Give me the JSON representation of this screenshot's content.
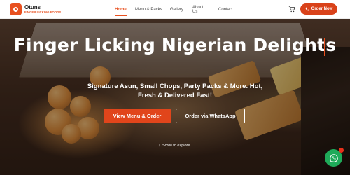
{
  "brand": {
    "name": "Otuns",
    "tagline": "FINGER LICKING FOODS",
    "accent": "#e8501f"
  },
  "nav": {
    "items": [
      {
        "label": "Home",
        "active": true
      },
      {
        "label": "Menu & Packs",
        "active": false
      },
      {
        "label": "Gallery",
        "active": false
      },
      {
        "label": "About Us",
        "active": false
      },
      {
        "label": "Contact",
        "active": false
      }
    ]
  },
  "header": {
    "cart_icon": "shopping-cart-icon",
    "order_button_label": "Order Now",
    "order_button_icon": "phone-icon"
  },
  "hero": {
    "title": "Finger Licking Nigerian Delights",
    "subtitle": "Signature Asun, Small Chops, Party Packs & More. Hot, Fresh & Delivered Fast!",
    "primary_button_label": "View Menu & Order",
    "secondary_button_label": "Order via WhatsApp",
    "scroll_hint": "Scroll to explore"
  },
  "floating": {
    "whatsapp_icon": "whatsapp-icon",
    "whatsapp_color": "#1faa59"
  }
}
